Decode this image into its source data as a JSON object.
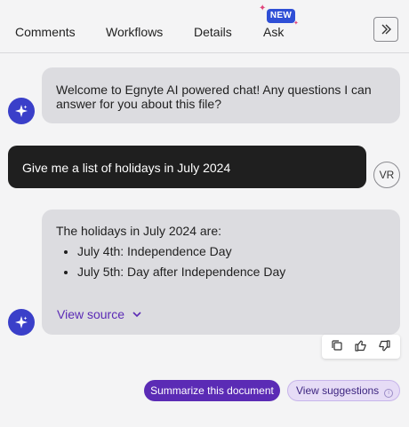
{
  "tabs": [
    {
      "label": "Comments"
    },
    {
      "label": "Workflows"
    },
    {
      "label": "Details"
    },
    {
      "label": "Ask",
      "badge": "NEW",
      "active": true
    }
  ],
  "icons": {
    "expand": "double-chevron-right-icon",
    "ai_avatar": "sparkle-icon",
    "source_toggle": "chevron-down-icon",
    "copy": "copy-icon",
    "thumbs_up": "thumbs-up-icon",
    "thumbs_down": "thumbs-down-icon",
    "info": "info-icon"
  },
  "colors": {
    "accent": "#5b2bb5",
    "badge": "#2f4fd6",
    "ai_bubble": "#dcdce0",
    "user_bubble": "#1f1f1f",
    "ai_avatar": "#3a3fc9"
  },
  "chat": {
    "welcome": "Welcome to Egnyte AI powered chat! Any questions I can answer for you about this file?",
    "user_message": "Give me a list of holidays in July 2024",
    "user_initials": "VR",
    "answer_intro": "The holidays in July 2024 are:",
    "answer_items": [
      "July 4th: Independence Day",
      "July 5th: Day after Independence Day"
    ],
    "view_source": "View source"
  },
  "suggestions": {
    "summarize": "Summarize this document",
    "view_suggestions": "View suggestions"
  }
}
